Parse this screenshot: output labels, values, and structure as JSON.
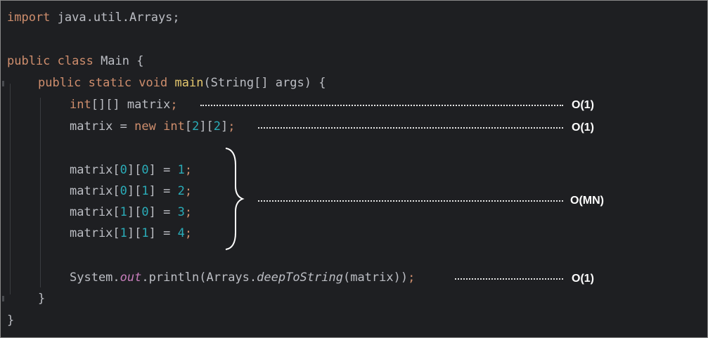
{
  "code": {
    "import": {
      "kw": "import",
      "rest": " java.util.Arrays;"
    },
    "class_decl": {
      "kw": "public class",
      "rest": " Main {"
    },
    "main_decl": {
      "kw": "public static void",
      "sp": " ",
      "fn": "main",
      "rest": "(String[] args) {"
    },
    "matrix_decl": {
      "kw": "int",
      "rest": "[][] matrix",
      "semi": ";"
    },
    "matrix_alloc": {
      "a": "matrix = ",
      "kw1": "new",
      "sp": " ",
      "kw2": "int",
      "b1": "[",
      "n1": "2",
      "b2": "][",
      "n2": "2",
      "b3": "]",
      "semi": ";"
    },
    "assigns": [
      {
        "pre": "matrix[",
        "i": "0",
        "mid": "][",
        "j": "0",
        "post": "] = ",
        "val": "1",
        "semi": ";"
      },
      {
        "pre": "matrix[",
        "i": "0",
        "mid": "][",
        "j": "1",
        "post": "] = ",
        "val": "2",
        "semi": ";"
      },
      {
        "pre": "matrix[",
        "i": "1",
        "mid": "][",
        "j": "0",
        "post": "] = ",
        "val": "3",
        "semi": ";"
      },
      {
        "pre": "matrix[",
        "i": "1",
        "mid": "][",
        "j": "1",
        "post": "] = ",
        "val": "4",
        "semi": ";"
      }
    ],
    "println": {
      "a": "System.",
      "field": "out",
      "b": ".println(Arrays.",
      "method": "deepToString",
      "c": "(matrix))",
      "semi": ";"
    },
    "close_method": "}",
    "close_class": "}"
  },
  "annotations": {
    "matrix_decl": "O(1)",
    "matrix_alloc": "O(1)",
    "assign_block": "O(MN)",
    "println": "O(1)"
  },
  "colors": {
    "background": "#1e1f22",
    "keyword": "#cf8e6d",
    "function": "#e6c86e",
    "number": "#2aacb8",
    "field": "#c77dbb",
    "text": "#bcbec4",
    "annotation": "#ffffff"
  }
}
